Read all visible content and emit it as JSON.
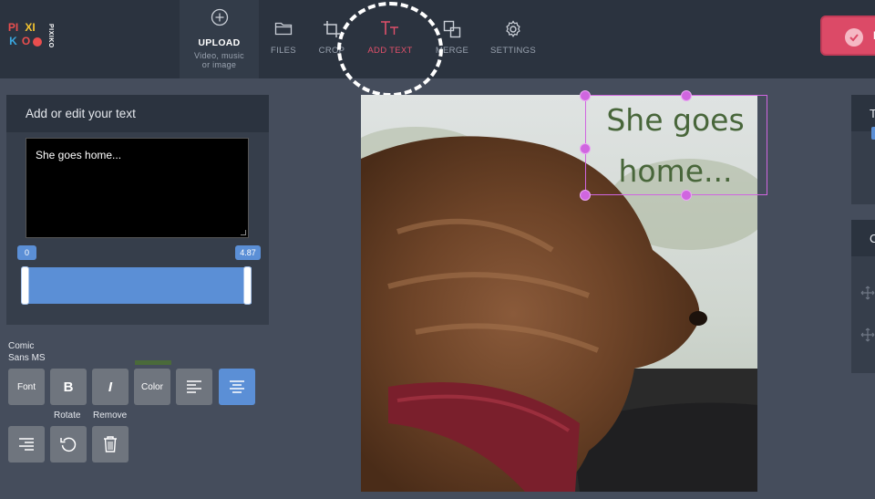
{
  "logo": {
    "letters": [
      {
        "ch": "PI",
        "color": "#e94e4e"
      },
      {
        "ch": "XI",
        "color": "#f4c430"
      },
      {
        "ch": "K",
        "color": "#3aa8e0"
      },
      {
        "ch": "O",
        "color": "#e94e4e"
      }
    ],
    "side_text": "PIXIKO"
  },
  "toolbar": {
    "upload": {
      "label": "UPLOAD",
      "sub1": "Video, music",
      "sub2": "or image"
    },
    "files": "FILES",
    "crop": "CROP",
    "add_text": "ADD TEXT",
    "merge": "MERGE",
    "settings": "SETTINGS",
    "export_label": "D"
  },
  "text_panel": {
    "title": "Add or edit your text",
    "value": "She goes home...",
    "timeline": {
      "start": "0",
      "end": "4.87"
    }
  },
  "format": {
    "font_name_line1": "Comic",
    "font_name_line2": "Sans MS",
    "font_btn": "Font",
    "bold_btn": "B",
    "italic_btn": "I",
    "color_btn": "Color",
    "rotate_label": "Rotate",
    "remove_label": "Remove",
    "text_color": "#4a6a3a"
  },
  "canvas": {
    "overlay_line1": "She goes",
    "overlay_line2": "home..."
  },
  "right_panels": {
    "panel1_title": "T",
    "panel2_title": "C"
  },
  "colors": {
    "accent": "#5b8fd6",
    "active_tool": "#e0506a",
    "handle": "#d066e0",
    "export": "#dc4a67"
  }
}
